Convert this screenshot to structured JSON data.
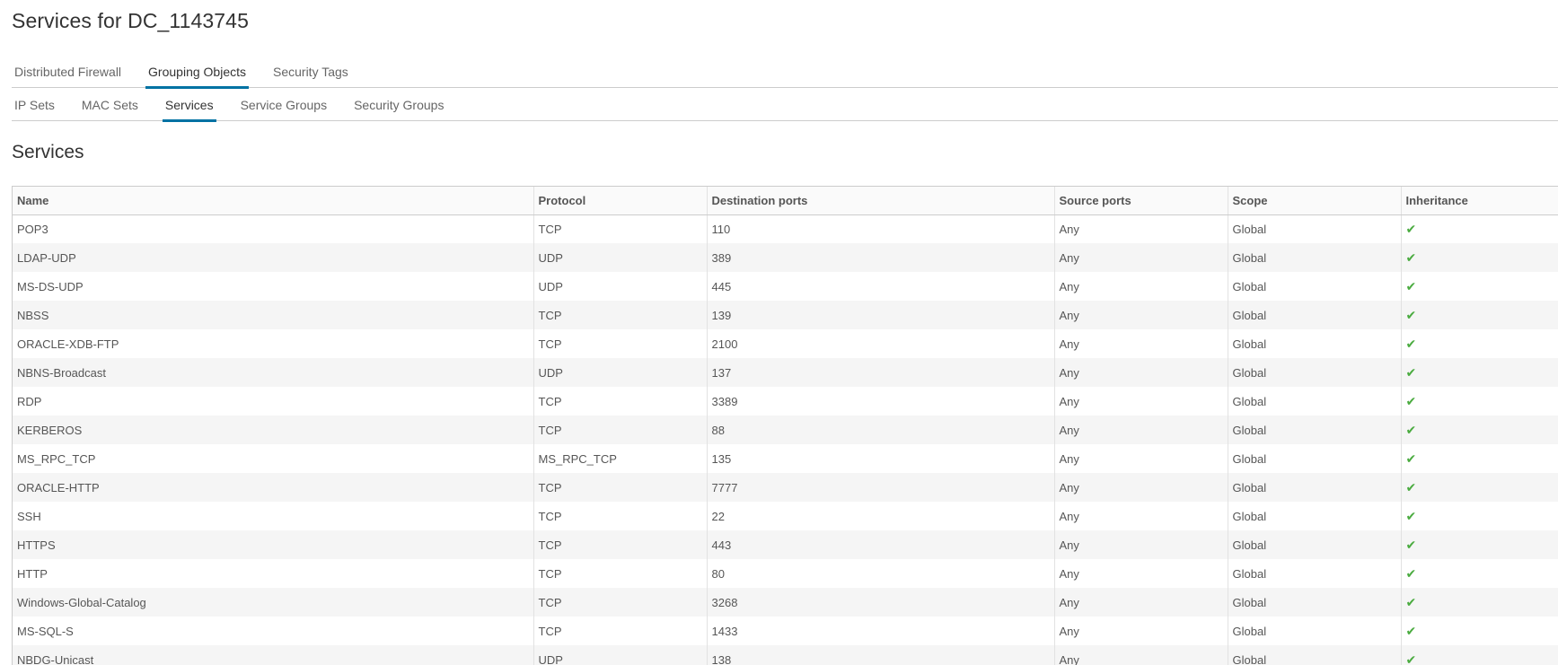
{
  "page": {
    "title": "Services for DC_1143745"
  },
  "tabs_primary": [
    {
      "label": "Distributed Firewall",
      "active": false
    },
    {
      "label": "Grouping Objects",
      "active": true
    },
    {
      "label": "Security Tags",
      "active": false
    }
  ],
  "tabs_secondary": [
    {
      "label": "IP Sets",
      "active": false
    },
    {
      "label": "MAC Sets",
      "active": false
    },
    {
      "label": "Services",
      "active": true
    },
    {
      "label": "Service Groups",
      "active": false
    },
    {
      "label": "Security Groups",
      "active": false
    }
  ],
  "section": {
    "title": "Services"
  },
  "table": {
    "columns": [
      "Name",
      "Protocol",
      "Destination ports",
      "Source ports",
      "Scope",
      "Inheritance"
    ],
    "rows": [
      {
        "name": "POP3",
        "protocol": "TCP",
        "destination_ports": "110",
        "source_ports": "Any",
        "scope": "Global",
        "inheritance": "✔"
      },
      {
        "name": "LDAP-UDP",
        "protocol": "UDP",
        "destination_ports": "389",
        "source_ports": "Any",
        "scope": "Global",
        "inheritance": "✔"
      },
      {
        "name": "MS-DS-UDP",
        "protocol": "UDP",
        "destination_ports": "445",
        "source_ports": "Any",
        "scope": "Global",
        "inheritance": "✔"
      },
      {
        "name": "NBSS",
        "protocol": "TCP",
        "destination_ports": "139",
        "source_ports": "Any",
        "scope": "Global",
        "inheritance": "✔"
      },
      {
        "name": "ORACLE-XDB-FTP",
        "protocol": "TCP",
        "destination_ports": "2100",
        "source_ports": "Any",
        "scope": "Global",
        "inheritance": "✔"
      },
      {
        "name": "NBNS-Broadcast",
        "protocol": "UDP",
        "destination_ports": "137",
        "source_ports": "Any",
        "scope": "Global",
        "inheritance": "✔"
      },
      {
        "name": "RDP",
        "protocol": "TCP",
        "destination_ports": "3389",
        "source_ports": "Any",
        "scope": "Global",
        "inheritance": "✔"
      },
      {
        "name": "KERBEROS",
        "protocol": "TCP",
        "destination_ports": "88",
        "source_ports": "Any",
        "scope": "Global",
        "inheritance": "✔"
      },
      {
        "name": "MS_RPC_TCP",
        "protocol": "MS_RPC_TCP",
        "destination_ports": "135",
        "source_ports": "Any",
        "scope": "Global",
        "inheritance": "✔"
      },
      {
        "name": "ORACLE-HTTP",
        "protocol": "TCP",
        "destination_ports": "7777",
        "source_ports": "Any",
        "scope": "Global",
        "inheritance": "✔"
      },
      {
        "name": "SSH",
        "protocol": "TCP",
        "destination_ports": "22",
        "source_ports": "Any",
        "scope": "Global",
        "inheritance": "✔"
      },
      {
        "name": "HTTPS",
        "protocol": "TCP",
        "destination_ports": "443",
        "source_ports": "Any",
        "scope": "Global",
        "inheritance": "✔"
      },
      {
        "name": "HTTP",
        "protocol": "TCP",
        "destination_ports": "80",
        "source_ports": "Any",
        "scope": "Global",
        "inheritance": "✔"
      },
      {
        "name": "Windows-Global-Catalog",
        "protocol": "TCP",
        "destination_ports": "3268",
        "source_ports": "Any",
        "scope": "Global",
        "inheritance": "✔"
      },
      {
        "name": "MS-SQL-S",
        "protocol": "TCP",
        "destination_ports": "1433",
        "source_ports": "Any",
        "scope": "Global",
        "inheritance": "✔"
      },
      {
        "name": "NBDG-Unicast",
        "protocol": "UDP",
        "destination_ports": "138",
        "source_ports": "Any",
        "scope": "Global",
        "inheritance": "✔"
      }
    ]
  },
  "colors": {
    "accent": "#0072a3",
    "check": "#4aab3f",
    "row_alt": "#f5f5f5"
  },
  "icons": {
    "inheritance": "check-icon"
  }
}
